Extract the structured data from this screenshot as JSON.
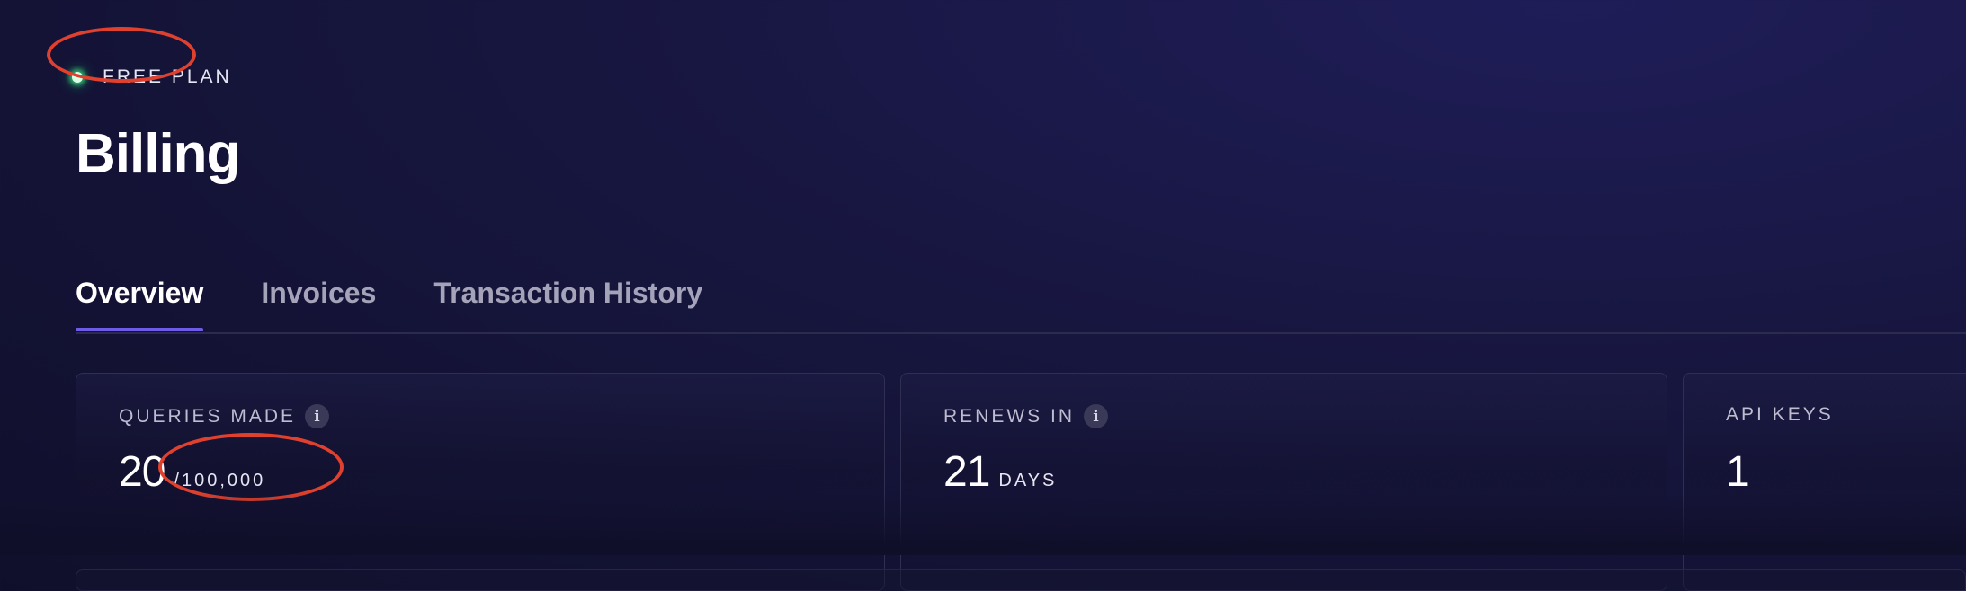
{
  "header": {
    "plan_badge": "FREE PLAN",
    "title": "Billing"
  },
  "tabs": [
    {
      "label": "Overview",
      "active": true
    },
    {
      "label": "Invoices",
      "active": false
    },
    {
      "label": "Transaction History",
      "active": false
    }
  ],
  "stats": {
    "queries": {
      "label": "QUERIES MADE",
      "value": "20",
      "suffix": "/100,000",
      "info_icon": "info-icon"
    },
    "renews": {
      "label": "RENEWS IN",
      "value": "21",
      "suffix": "DAYS",
      "info_icon": "info-icon"
    },
    "api_keys": {
      "label": "API KEYS",
      "value": "1"
    }
  },
  "colors": {
    "accent": "#6c5ce7",
    "plan_dot": "#3ce682",
    "annotation": "#e0402e",
    "background": "#15143a"
  }
}
